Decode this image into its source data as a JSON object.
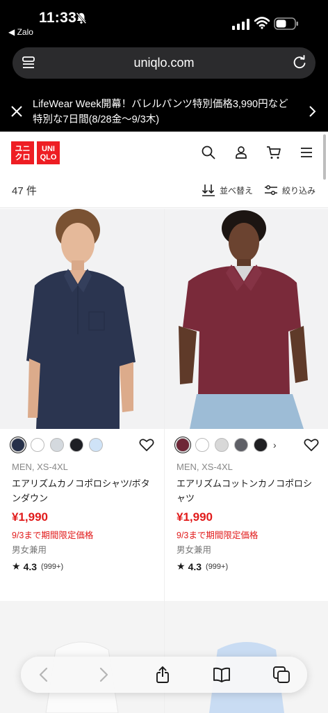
{
  "status": {
    "time": "11:33",
    "back_app": "◀ Zalo"
  },
  "browser": {
    "url": "uniqlo.com"
  },
  "promo": {
    "text": "LifeWear Week開幕！バレルパンツ特別価格3,990円など特別な7日間(8/28金〜9/3木)"
  },
  "header": {
    "logo_top_left": "ユニ",
    "logo_bottom_left": "クロ",
    "logo_top_right": "UNI",
    "logo_bottom_right": "QLO"
  },
  "results": {
    "count": "47 件",
    "sort_label": "並べ替え",
    "filter_label": "絞り込み"
  },
  "products": [
    {
      "meta": "MEN, XS-4XL",
      "name": "エアリズムカノコポロシャツ/ボタンダウン",
      "price": "¥1,990",
      "limited": "9/3まで期間限定価格",
      "unisex": "男女兼用",
      "rating": "4.3",
      "review_count": "(999+)",
      "swatches": [
        "#27314a",
        "#ffffff",
        "#d4d9de",
        "#1e1f24",
        "#cfe3f7"
      ]
    },
    {
      "meta": "MEN, XS-4XL",
      "name": "エアリズムコットンカノコポロシャツ",
      "price": "¥1,990",
      "limited": "9/3まで期間限定価格",
      "unisex": "男女兼用",
      "rating": "4.3",
      "review_count": "(999+)",
      "swatches": [
        "#6e2636",
        "#ffffff",
        "#d8d8d8",
        "#5e5f66",
        "#1f1f22"
      ]
    }
  ],
  "colors": {
    "brand_red": "#ee1d23",
    "price_red": "#e11b1b"
  }
}
